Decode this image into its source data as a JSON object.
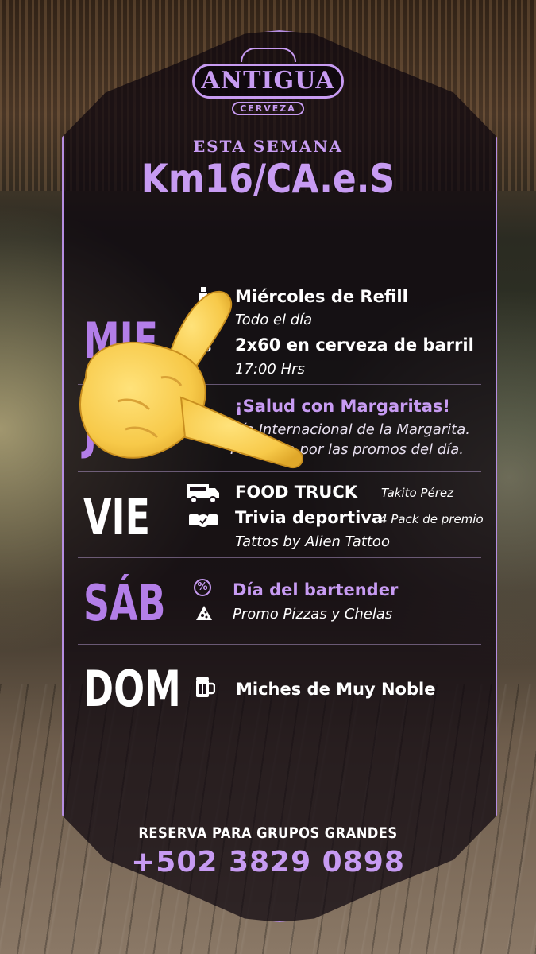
{
  "logo": {
    "brand": "ANTIGUA",
    "sub": "CERVEZA"
  },
  "header": {
    "week_label": "ESTA SEMANA",
    "location": "Km16/CA.e.S"
  },
  "days": [
    {
      "label": "MIE",
      "lines": [
        {
          "icon": "bottle-icon",
          "text": "Miércoles de Refill"
        },
        {
          "text": "Todo el día"
        },
        {
          "icon": "percent-icon",
          "text": "2x60 en cerveza de barril"
        },
        {
          "text": "17:00 Hrs"
        }
      ]
    },
    {
      "label": "JUE",
      "lines": [
        {
          "text": "¡Salud con Margaritas!"
        },
        {
          "text": "Día Internacional de la Margarita."
        },
        {
          "text": "Pregunta por las promos del día."
        }
      ]
    },
    {
      "label": "VIE",
      "lines": [
        {
          "icon": "food-truck-icon",
          "text": "FOOD TRUCK",
          "extra": "Takito Pérez"
        },
        {
          "icon": "trivia-icon",
          "text": "Trivia deportiva",
          "extra": "4 Pack de premio"
        },
        {
          "text": "Tattos by Alien Tattoo"
        }
      ]
    },
    {
      "label": "SÁB",
      "lines": [
        {
          "icon": "percent-icon",
          "text": "Día del bartender"
        },
        {
          "icon": "pizza-icon",
          "text": "Promo Pizzas y Chelas"
        }
      ]
    },
    {
      "label": "DOM",
      "lines": [
        {
          "icon": "beer-mug-icon",
          "text": "Miches de Muy Noble"
        }
      ]
    }
  ],
  "footer": {
    "cta_label": "RESERVA PARA GRUPOS GRANDES",
    "phone": "+502 3829 0898"
  },
  "colors": {
    "accent": "#c79bf2",
    "day_purple": "#b37ee8",
    "panel": "#0c060e"
  }
}
